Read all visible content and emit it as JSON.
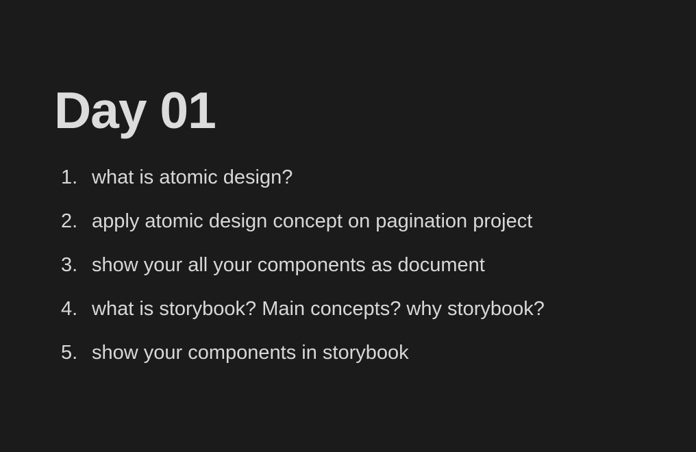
{
  "document": {
    "title": "Day 01",
    "items": [
      {
        "number": "1.",
        "text": "what is atomic design?"
      },
      {
        "number": "2.",
        "text": "apply atomic design concept on pagination project"
      },
      {
        "number": "3.",
        "text": "show your all your components as document"
      },
      {
        "number": "4.",
        "text": "what is storybook? Main concepts? why storybook?"
      },
      {
        "number": "5.",
        "text": "show your components in storybook"
      }
    ]
  },
  "colors": {
    "background": "#1b1b1b",
    "title": "#dcdcdc",
    "text": "#d8d8d8"
  }
}
